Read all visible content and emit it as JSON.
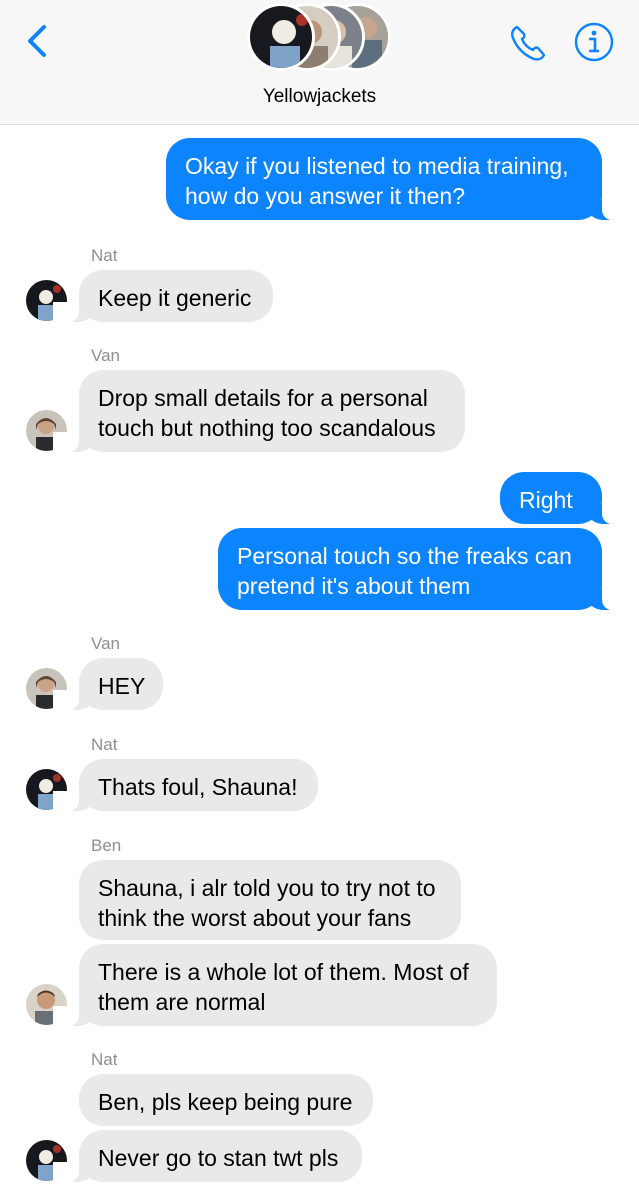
{
  "header": {
    "title": "Yellowjackets",
    "back_icon": "chevron-left-icon",
    "call_icon": "phone-icon",
    "info_icon": "info-icon",
    "accent_color": "#0b84fe"
  },
  "messages": [
    {
      "direction": "out",
      "text": "Okay if you listened to media training,\nhow do you answer it then?"
    },
    {
      "direction": "in",
      "sender": "Nat",
      "text": "Keep it generic"
    },
    {
      "direction": "in",
      "sender": "Van",
      "text": "Drop small details for a personal\ntouch but nothing too scandalous"
    },
    {
      "direction": "out",
      "text": "Right"
    },
    {
      "direction": "out",
      "text": "Personal touch so the freaks can\npretend it's about them"
    },
    {
      "direction": "in",
      "sender": "Van",
      "text": "HEY"
    },
    {
      "direction": "in",
      "sender": "Nat",
      "text": "Thats foul, Shauna!"
    },
    {
      "direction": "in",
      "sender": "Ben",
      "text": "Shauna, i alr told you to try not to\nthink the worst about your fans"
    },
    {
      "direction": "in",
      "text": "There is a whole lot of them. Most of\nthem are normal"
    },
    {
      "direction": "in",
      "sender": "Nat",
      "text": "Ben, pls keep being pure"
    },
    {
      "direction": "in",
      "text": "Never go to stan twt pls"
    }
  ]
}
